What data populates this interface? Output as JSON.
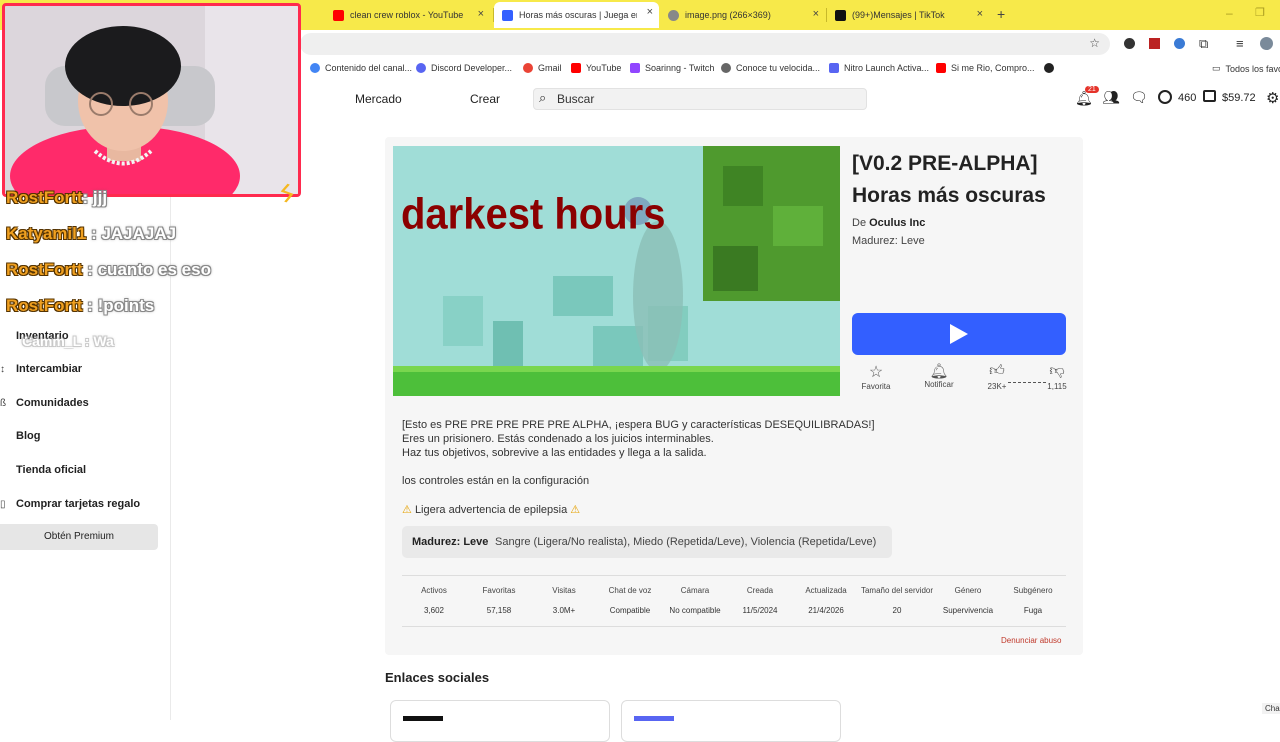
{
  "browser": {
    "tabs": [
      {
        "label": "clean crew roblox - YouTube",
        "color": "#ff0000"
      },
      {
        "label": "Horas más oscuras | Juega en R",
        "color": "#335fff",
        "active": true
      },
      {
        "label": "image.png (266×369)",
        "color": "#777777"
      },
      {
        "label": "(99+)Mensajes | TikTok",
        "color": "#111111"
      }
    ],
    "new_tab": "+",
    "close_tab": "×",
    "bookmarks": [
      {
        "label": "Contenido del canal...",
        "color": "#4285f4"
      },
      {
        "label": "Discord Developer...",
        "color": "#5865f2"
      },
      {
        "label": "Gmail",
        "color": "#ea4335"
      },
      {
        "label": "YouTube",
        "color": "#ff0000"
      },
      {
        "label": "Soarinng - Twitch",
        "color": "#9146ff"
      },
      {
        "label": "Conoce tu velocida...",
        "color": "#666666"
      },
      {
        "label": "Nitro Launch Activa...",
        "color": "#5865f2"
      },
      {
        "label": "Si me Rio, Compro...",
        "color": "#ff0000"
      }
    ],
    "all_favorites": "Todos los favo"
  },
  "header": {
    "nav": [
      "Mercado",
      "Crear"
    ],
    "search_placeholder": "Buscar",
    "notif_count": "21",
    "robux": "460",
    "balance": "$59.72"
  },
  "sidebar": {
    "items": [
      "Inventario",
      "Intercambiar",
      "Comunidades",
      "Blog",
      "Tienda oficial",
      "Comprar tarjetas regalo"
    ],
    "premium": "Obtén Premium"
  },
  "game": {
    "thumb_text": "darkest hours",
    "title_line1": "[V0.2 PRE-ALPHA]",
    "title_line2": "Horas más oscuras",
    "by_prefix": "De",
    "creator": "Oculus Inc",
    "maturity_meta": "Madurez: Leve",
    "actions": {
      "favorite": "Favorita",
      "notify": "Notificar",
      "likes": "23K+",
      "dislikes": "1,115"
    },
    "description": [
      "[Esto es PRE PRE PRE PRE PRE ALPHA, ¡espera BUG y características DESEQUILIBRADAS!]",
      "Eres un prisionero. Estás condenado a los juicios interminables.",
      "Haz tus objetivos, sobrevive a las entidades y llega a la salida.",
      "los controles están en la configuración"
    ],
    "warning": "Ligera advertencia de epilepsia",
    "maturity_label": "Madurez: Leve",
    "maturity_detail": "Sangre (Ligera/No realista), Miedo (Repetida/Leve), Violencia (Repetida/Leve)",
    "stats": [
      {
        "label": "Activos",
        "value": "3,602"
      },
      {
        "label": "Favoritas",
        "value": "57,158"
      },
      {
        "label": "Visitas",
        "value": "3.0M+"
      },
      {
        "label": "Chat de voz",
        "value": "Compatible"
      },
      {
        "label": "Cámara",
        "value": "No compatible"
      },
      {
        "label": "Creada",
        "value": "11/5/2024"
      },
      {
        "label": "Actualizada",
        "value": "21/4/2026"
      },
      {
        "label": "Tamaño del servidor",
        "value": "20"
      },
      {
        "label": "Género",
        "value": "Supervivencia"
      },
      {
        "label": "Subgénero",
        "value": "Fuga"
      }
    ],
    "report": "Denunciar abuso",
    "social_heading": "Enlaces sociales"
  },
  "stream_chat": [
    {
      "user": "RostFortt",
      "msg": ": jjj"
    },
    {
      "user": "Katyamil1",
      "msg": ": JAJAJAJ"
    },
    {
      "user": "RostFortt",
      "msg": ": cuanto es eso"
    },
    {
      "user": "RostFortt",
      "msg": ": !points"
    },
    {
      "user": "Camm_L",
      "msg": ": Wa"
    }
  ],
  "corner_label": "Cha",
  "colors": {
    "tabbar": "#f7e94a",
    "play_button": "#335fff",
    "webcam_border": "#ff2a4e",
    "report": "#c0392b"
  }
}
